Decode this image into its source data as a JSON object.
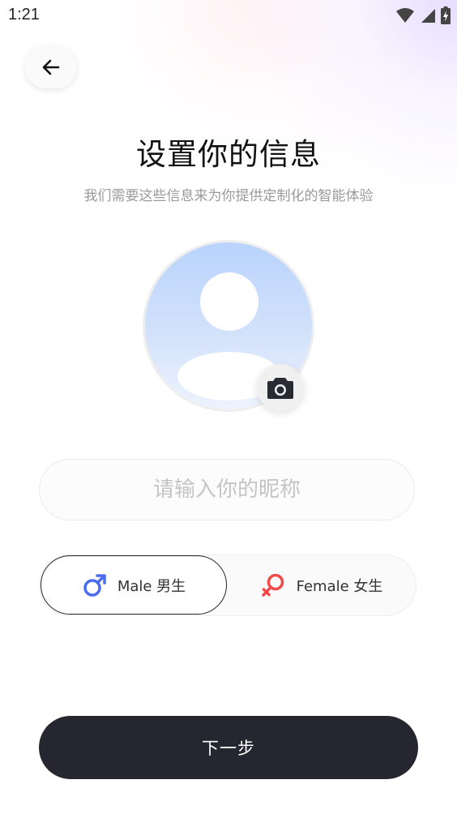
{
  "status_bar": {
    "time": "1:21"
  },
  "header": {
    "title": "设置你的信息",
    "subtitle": "我们需要这些信息来为你提供定制化的智能体验"
  },
  "form": {
    "nickname_placeholder": "请输入你的昵称",
    "nickname_value": "",
    "gender_options": [
      {
        "label": "Male 男生",
        "selected": true,
        "icon": "male-symbol-icon",
        "color": "#4a6cf0"
      },
      {
        "label": "Female 女生",
        "selected": false,
        "icon": "female-symbol-icon",
        "color": "#f04a4a"
      }
    ],
    "next_label": "下一步"
  }
}
